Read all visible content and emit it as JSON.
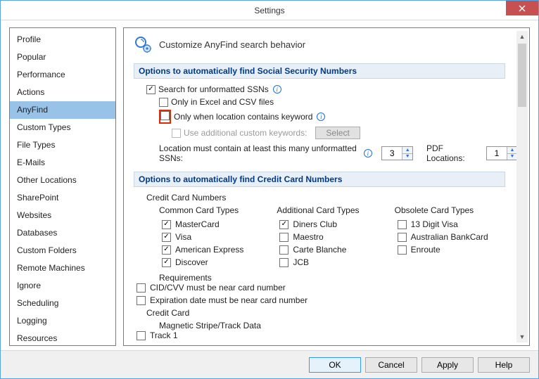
{
  "window": {
    "title": "Settings"
  },
  "sidebar": {
    "items": [
      {
        "label": "Profile"
      },
      {
        "label": "Popular"
      },
      {
        "label": "Performance"
      },
      {
        "label": "Actions"
      },
      {
        "label": "AnyFind",
        "selected": true
      },
      {
        "label": "Custom Types"
      },
      {
        "label": "File Types"
      },
      {
        "label": "E-Mails"
      },
      {
        "label": "Other Locations"
      },
      {
        "label": "SharePoint"
      },
      {
        "label": "Websites"
      },
      {
        "label": "Databases"
      },
      {
        "label": "Custom Folders"
      },
      {
        "label": "Remote Machines"
      },
      {
        "label": "Ignore"
      },
      {
        "label": "Scheduling"
      },
      {
        "label": "Logging"
      },
      {
        "label": "Resources"
      }
    ]
  },
  "panel": {
    "header": "Customize AnyFind search behavior",
    "ssn": {
      "section_title": "Options to automatically find Social Security Numbers",
      "search_unformatted": {
        "label": "Search for unformatted SSNs",
        "checked": true
      },
      "only_excel_csv": {
        "label": "Only in Excel and CSV files",
        "checked": false
      },
      "only_keyword": {
        "label": "Only when location contains keyword",
        "checked": false
      },
      "use_custom_kw": {
        "label": "Use additional custom keywords:",
        "checked": false,
        "button": "Select"
      },
      "min_count": {
        "label": "Location must contain at least this many unformatted SSNs:",
        "value": "3"
      },
      "pdf_locations": {
        "label": "PDF Locations:",
        "value": "1"
      }
    },
    "cc": {
      "section_title": "Options to automatically find Credit Card Numbers",
      "group_label": "Credit Card Numbers",
      "common": {
        "title": "Common Card Types",
        "items": [
          {
            "label": "MasterCard",
            "checked": true
          },
          {
            "label": "Visa",
            "checked": true
          },
          {
            "label": "American Express",
            "checked": true
          },
          {
            "label": "Discover",
            "checked": true
          }
        ]
      },
      "additional": {
        "title": "Additional Card Types",
        "items": [
          {
            "label": "Diners Club",
            "checked": true
          },
          {
            "label": "Maestro",
            "checked": false
          },
          {
            "label": "Carte Blanche",
            "checked": false
          },
          {
            "label": "JCB",
            "checked": false
          }
        ]
      },
      "obsolete": {
        "title": "Obsolete Card Types",
        "items": [
          {
            "label": "13 Digit Visa",
            "checked": false
          },
          {
            "label": "Australian BankCard",
            "checked": false
          },
          {
            "label": "Enroute",
            "checked": false
          }
        ]
      },
      "requirements": {
        "title": "Requirements",
        "items": [
          {
            "label": "CID/CVV must be near card number",
            "checked": false
          },
          {
            "label": "Expiration date must be near card number",
            "checked": false
          }
        ]
      },
      "credit_card_group": "Credit Card",
      "mag_stripe": {
        "title": "Magnetic Stripe/Track Data",
        "track1": {
          "label": "Track 1",
          "checked": false
        }
      }
    }
  },
  "footer": {
    "ok": "OK",
    "cancel": "Cancel",
    "apply": "Apply",
    "help": "Help"
  }
}
